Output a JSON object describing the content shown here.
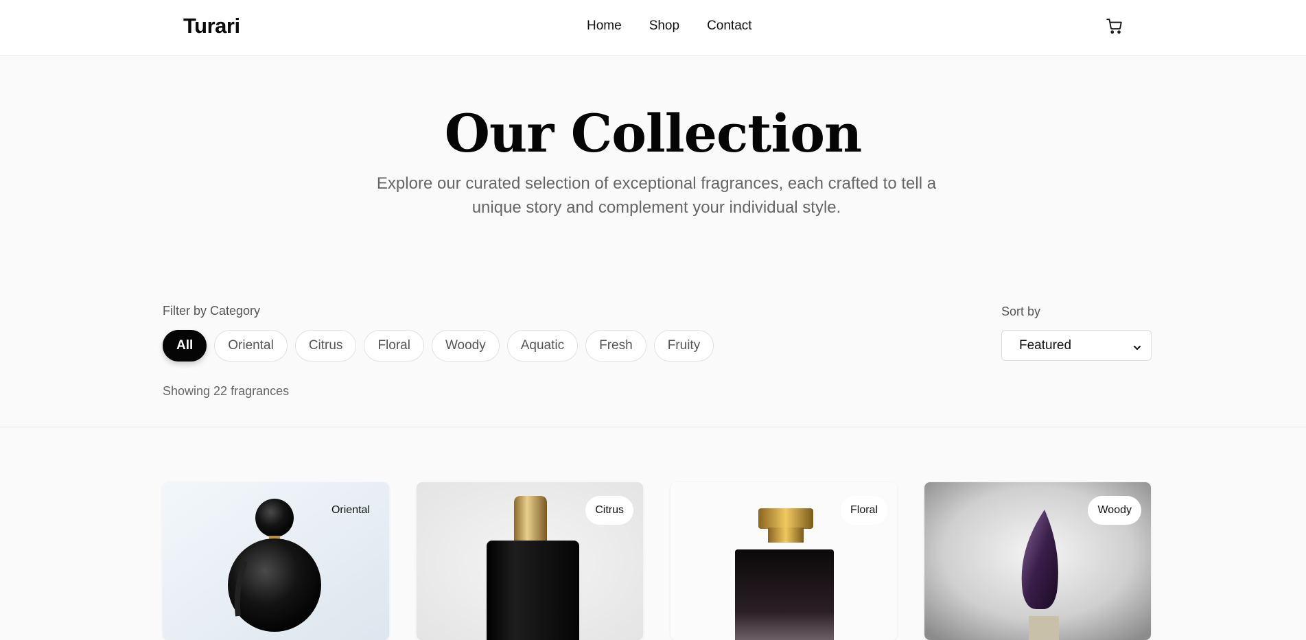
{
  "header": {
    "logo": "Turari",
    "nav": [
      {
        "label": "Home"
      },
      {
        "label": "Shop"
      },
      {
        "label": "Contact"
      }
    ],
    "cart_icon": "cart-icon"
  },
  "hero": {
    "title": "Our Collection",
    "subtitle": "Explore our curated selection of exceptional fragrances, each crafted to tell a unique story and complement your individual style."
  },
  "filter": {
    "label": "Filter by Category",
    "categories": [
      {
        "label": "All",
        "active": true
      },
      {
        "label": "Oriental",
        "active": false
      },
      {
        "label": "Citrus",
        "active": false
      },
      {
        "label": "Floral",
        "active": false
      },
      {
        "label": "Woody",
        "active": false
      },
      {
        "label": "Aquatic",
        "active": false
      },
      {
        "label": "Fresh",
        "active": false
      },
      {
        "label": "Fruity",
        "active": false
      }
    ]
  },
  "sort": {
    "label": "Sort by",
    "selected": "Featured"
  },
  "results": {
    "count_text": "Showing 22 fragrances"
  },
  "products": [
    {
      "category": "Oriental"
    },
    {
      "category": "Citrus"
    },
    {
      "category": "Floral"
    },
    {
      "category": "Woody"
    }
  ],
  "colors": {
    "accent": "#050505",
    "background": "#fafafa",
    "muted_text": "#666666"
  }
}
